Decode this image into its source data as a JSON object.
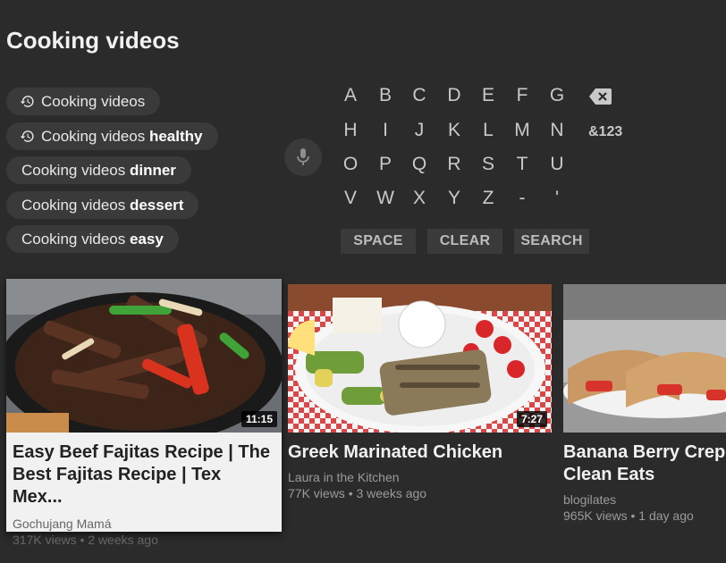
{
  "search": {
    "query": "Cooking videos"
  },
  "suggestions": [
    {
      "prefix": "Cooking videos",
      "bold": "",
      "history": true
    },
    {
      "prefix": "Cooking videos ",
      "bold": "healthy",
      "history": true
    },
    {
      "prefix": "Cooking videos ",
      "bold": "dinner",
      "history": false
    },
    {
      "prefix": "Cooking videos ",
      "bold": "dessert",
      "history": false
    },
    {
      "prefix": "Cooking videos ",
      "bold": "easy",
      "history": false
    }
  ],
  "keyboard": {
    "rows": [
      [
        "A",
        "B",
        "C",
        "D",
        "E",
        "F",
        "G"
      ],
      [
        "H",
        "I",
        "J",
        "K",
        "L",
        "M",
        "N"
      ],
      [
        "O",
        "P",
        "Q",
        "R",
        "S",
        "T",
        "U"
      ],
      [
        "V",
        "W",
        "X",
        "Y",
        "Z",
        "-",
        "'"
      ]
    ],
    "numbers_label": "&123",
    "space_label": "SPACE",
    "clear_label": "CLEAR",
    "search_label": "SEARCH"
  },
  "videos": [
    {
      "title": "Easy Beef Fajitas Recipe | The Best Fajitas Recipe | Tex Mex...",
      "channel": "Gochujang Mamá",
      "stats": "317K views • 2 weeks ago",
      "duration": "11:15"
    },
    {
      "title": "Greek Marinated Chicken",
      "channel": "Laura in the Kitchen",
      "stats": "77K views • 3 weeks ago",
      "duration": "7:27"
    },
    {
      "title": "Banana Berry Crepes | Clean Eats",
      "channel": "blogilates",
      "stats": "965K views • 1 day ago",
      "duration": ""
    }
  ],
  "icons": {
    "history": "history-icon",
    "mic": "microphone-icon",
    "backspace": "backspace-icon"
  },
  "colors": {
    "background": "#2b2b2b",
    "chip": "#3a3a3a",
    "focused_card": "#f1f1f1"
  }
}
